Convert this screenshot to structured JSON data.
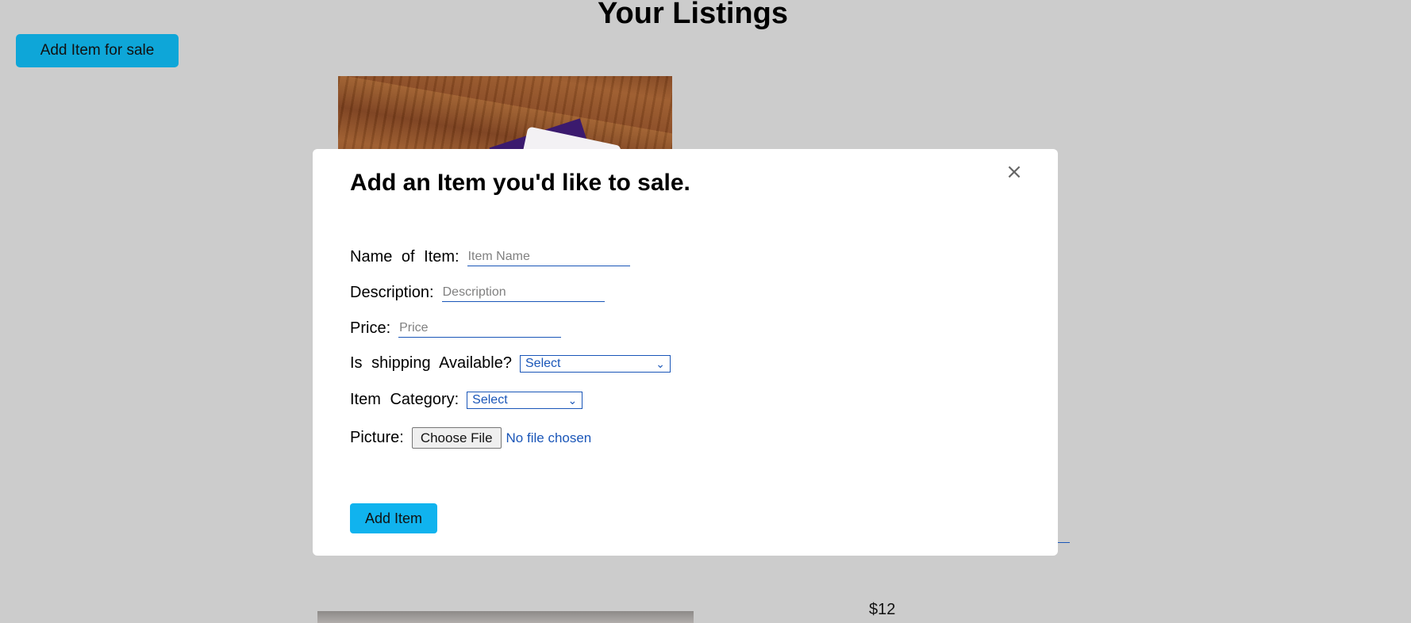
{
  "page": {
    "title": "Your Listings",
    "add_button_label": "Add Item for sale"
  },
  "listings": [
    {
      "image": "photo of cloth on wooden floor"
    },
    {
      "price": "$12"
    }
  ],
  "modal": {
    "title": "Add an Item you'd like to sale.",
    "close_icon": "×",
    "fields": {
      "name": {
        "label": "Name of Item:",
        "placeholder": "Item Name",
        "value": ""
      },
      "description": {
        "label": "Description:",
        "placeholder": "Description",
        "value": ""
      },
      "price": {
        "label": "Price:",
        "placeholder": "Price",
        "value": ""
      },
      "shipping": {
        "label": "Is shipping Available?",
        "selected": "Select"
      },
      "category": {
        "label": "Item Category:",
        "selected": "Select"
      },
      "picture": {
        "label": "Picture:",
        "button": "Choose File",
        "status": "No file chosen"
      }
    },
    "submit_label": "Add Item"
  },
  "colors": {
    "background": "#cccccc",
    "primary_button": "#0ea6d8",
    "submit_button": "#10b3ee",
    "field_accent": "#1a56b8"
  },
  "icons": [
    "close-icon",
    "chevron-down-icon"
  ]
}
